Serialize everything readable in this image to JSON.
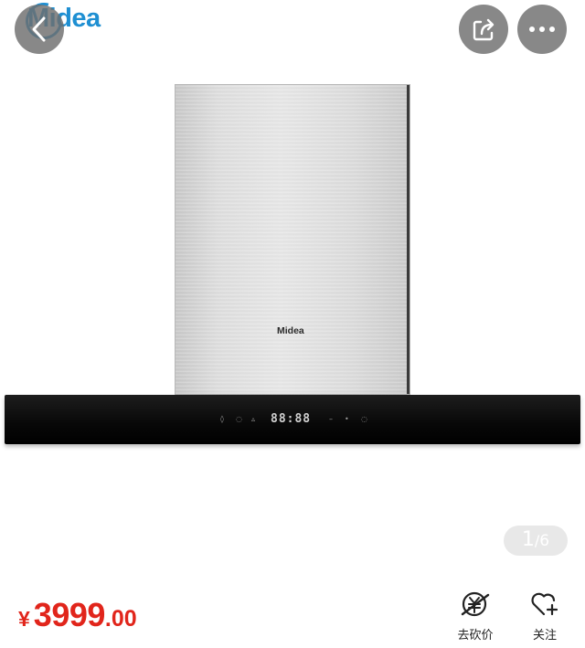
{
  "header": {
    "brand_logo_text": "Midea",
    "back_icon": "chevron-left-icon",
    "share_icon": "share-icon",
    "more_icon": "ellipsis-icon"
  },
  "product_image": {
    "panel_logo": "Midea",
    "display_readout": "88:88",
    "accent_color": "#1e8fd2"
  },
  "image_pager": {
    "current": "1",
    "separator": "/",
    "total": "6"
  },
  "bottom_bar": {
    "price_currency": "¥",
    "price_integer": "3999",
    "price_decimal": ".00",
    "price_color": "#e1251b",
    "bargain_label": "去砍价",
    "follow_label": "关注"
  }
}
